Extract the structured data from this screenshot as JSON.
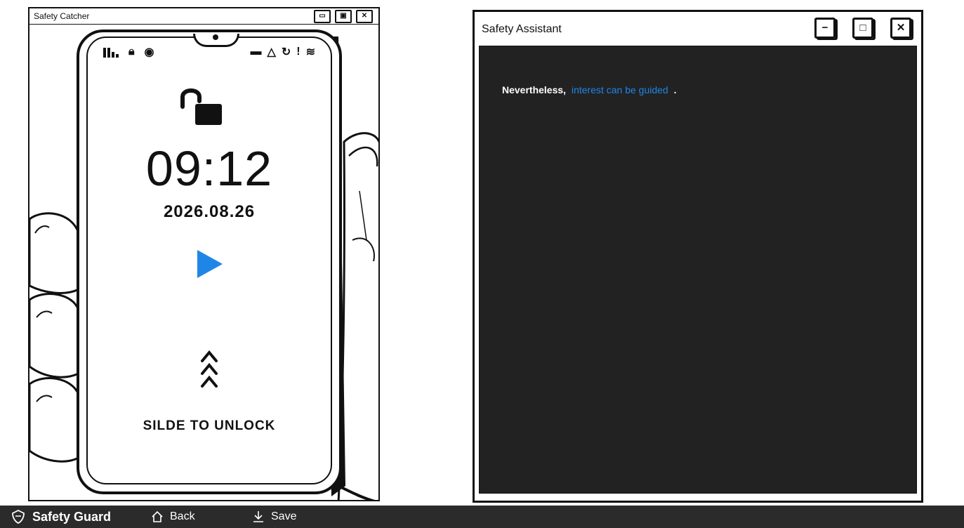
{
  "left_window": {
    "title": "Safety Catcher",
    "controls": [
      "minimize",
      "maximize",
      "close"
    ]
  },
  "phone": {
    "status_icons_left": [
      "signal-icon",
      "lock-icon",
      "eye-icon"
    ],
    "status_icons_right": [
      "battery-icon",
      "bell-icon",
      "sync-icon",
      "alert-icon",
      "wifi-icon"
    ],
    "time": "09:12",
    "date": "2026.08.26",
    "slide_text": "SILDE TO UNLOCK",
    "accent_color": "#1f86e8"
  },
  "right_window": {
    "title": "Safety Assistant",
    "dialog": {
      "prefix": "Nevertheless,",
      "link": "interest can be guided",
      "suffix": "."
    },
    "background_color": "#222222"
  },
  "taskbar": {
    "brand": "Safety Guard",
    "back_label": "Back",
    "save_label": "Save"
  }
}
